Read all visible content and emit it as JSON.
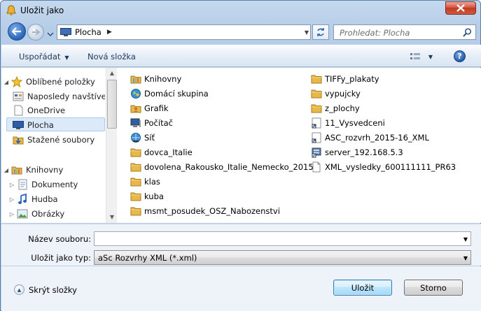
{
  "window": {
    "title": "Uložit jako"
  },
  "nav": {
    "address_location": "Plocha",
    "search_placeholder": "Prohledat: Plocha"
  },
  "toolbar": {
    "organize_label": "Uspořádat",
    "new_folder_label": "Nová složka"
  },
  "sidebar": {
    "items": [
      {
        "label": "Oblíbené položky",
        "icon": "star-icon",
        "level": 0
      },
      {
        "label": "Naposledy navštívené",
        "icon": "recent-places-icon",
        "level": 1
      },
      {
        "label": "OneDrive",
        "icon": "onedrive-icon",
        "level": 1
      },
      {
        "label": "Plocha",
        "icon": "desktop-icon",
        "level": 1,
        "selected": true
      },
      {
        "label": "Stažené soubory",
        "icon": "downloads-icon",
        "level": 1
      },
      {
        "label": "Knihovny",
        "icon": "libraries-icon",
        "level": 0
      },
      {
        "label": "Dokumenty",
        "icon": "documents-icon",
        "level": 1
      },
      {
        "label": "Hudba",
        "icon": "music-icon",
        "level": 1
      },
      {
        "label": "Obrázky",
        "icon": "pictures-icon",
        "level": 1
      }
    ]
  },
  "files": {
    "col1": [
      {
        "name": "Knihovny",
        "icon": "libraries-icon"
      },
      {
        "name": "Domácí skupina",
        "icon": "homegroup-icon"
      },
      {
        "name": "Grafik",
        "icon": "user-folder-icon"
      },
      {
        "name": "Počítač",
        "icon": "computer-icon"
      },
      {
        "name": "Síť",
        "icon": "network-icon"
      },
      {
        "name": "dovca_Italie",
        "icon": "folder-icon"
      },
      {
        "name": "dovolena_Rakousko_Italie_Nemecko_2015",
        "icon": "folder-icon"
      },
      {
        "name": "klas",
        "icon": "folder-icon"
      },
      {
        "name": "kuba",
        "icon": "folder-icon"
      },
      {
        "name": "msmt_posudek_OSZ_Nabozenstvi",
        "icon": "folder-icon"
      }
    ],
    "col2": [
      {
        "name": "TIFFy_plakaty",
        "icon": "folder-icon"
      },
      {
        "name": "vypujcky",
        "icon": "folder-icon"
      },
      {
        "name": "z_plochy",
        "icon": "folder-icon"
      },
      {
        "name": "11_Vysvedceni",
        "icon": "shortcut-icon"
      },
      {
        "name": "ASC_rozvrh_2015-16_XML",
        "icon": "shortcut-icon"
      },
      {
        "name": "server_192.168.5.3",
        "icon": "server-shortcut-icon"
      },
      {
        "name": "XML_vysledky_600111111_PR63",
        "icon": "document-icon"
      }
    ]
  },
  "form": {
    "filename_label": "Název souboru:",
    "filename_value": "",
    "filetype_label": "Uložit jako typ:",
    "filetype_value": "aSc Rozvrhy XML (*.xml)"
  },
  "footer": {
    "hide_folders_label": "Skrýt složky",
    "save_label": "Uložit",
    "cancel_label": "Storno"
  },
  "colors": {
    "accent": "#2a63b8",
    "selection": "#dbe9f8",
    "folder": "#e8b84a"
  }
}
